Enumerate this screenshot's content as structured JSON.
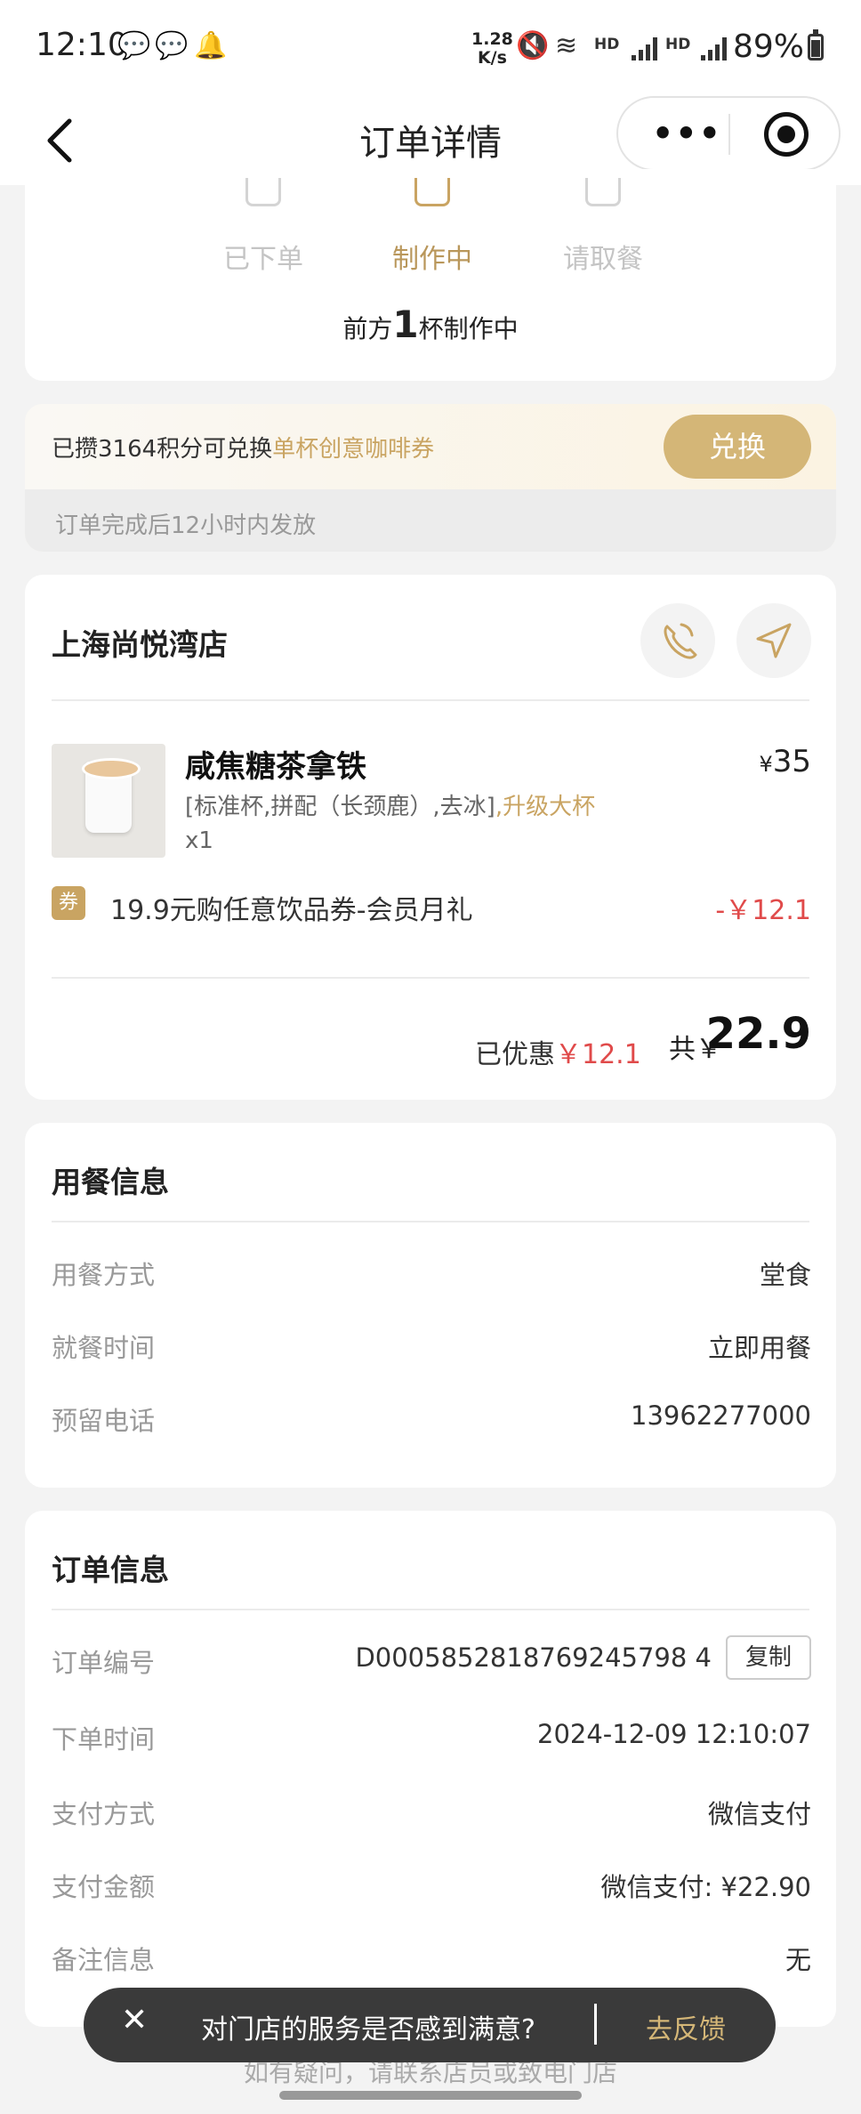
{
  "status_bar": {
    "time": "12:10",
    "speed_top": "1.28",
    "speed_bottom": "K/s",
    "hd1": "HD",
    "hd2": "HD",
    "battery": "89%"
  },
  "nav": {
    "title": "订单详情"
  },
  "progress": {
    "steps": [
      {
        "label": "已下单",
        "active": false
      },
      {
        "label": "制作中",
        "active": true
      },
      {
        "label": "请取餐",
        "active": false
      }
    ],
    "queue_prefix": "前方",
    "queue_count": "1",
    "queue_suffix": "杯制作中"
  },
  "points": {
    "text": "已攒3164积分可兑换",
    "highlight": "单杯创意咖啡券",
    "button": "兑换",
    "note": "订单完成后12小时内发放"
  },
  "store": {
    "name": "上海尚悦湾店",
    "product": {
      "name": "咸焦糖茶拿铁",
      "price_symbol": "¥",
      "price": "35",
      "spec": "[标准杯,拼配（长颈鹿）,去冰]",
      "upgrade": ",升级大杯",
      "qty": "x1"
    },
    "coupon": {
      "tag": "券",
      "name": "19.9元购任意饮品券-会员月礼",
      "amount": "-￥12.1"
    },
    "saved_label": "已优惠",
    "saved_value": "￥12.1",
    "total_label": "共￥",
    "total_value": "22.9"
  },
  "dining": {
    "title": "用餐信息",
    "rows": [
      {
        "label": "用餐方式",
        "value": "堂食"
      },
      {
        "label": "就餐时间",
        "value": "立即用餐"
      },
      {
        "label": "预留电话",
        "value": "13962277000"
      }
    ]
  },
  "order": {
    "title": "订单信息",
    "copy_button": "复制",
    "rows": [
      {
        "label": "订单编号",
        "value": "D0005852818769245798 4"
      },
      {
        "label": "下单时间",
        "value": "2024-12-09 12:10:07"
      },
      {
        "label": "支付方式",
        "value": "微信支付"
      },
      {
        "label": "支付金额",
        "value": "微信支付: ¥22.90"
      },
      {
        "label": "备注信息",
        "value": "无"
      }
    ]
  },
  "footer": {
    "note": "如有疑问，请联系店员或致电门店"
  },
  "toast": {
    "text": "对门店的服务是否感到满意?",
    "action": "去反馈"
  },
  "colors": {
    "accent_gold": "#c9a462",
    "discount_red": "#e04a4a"
  }
}
